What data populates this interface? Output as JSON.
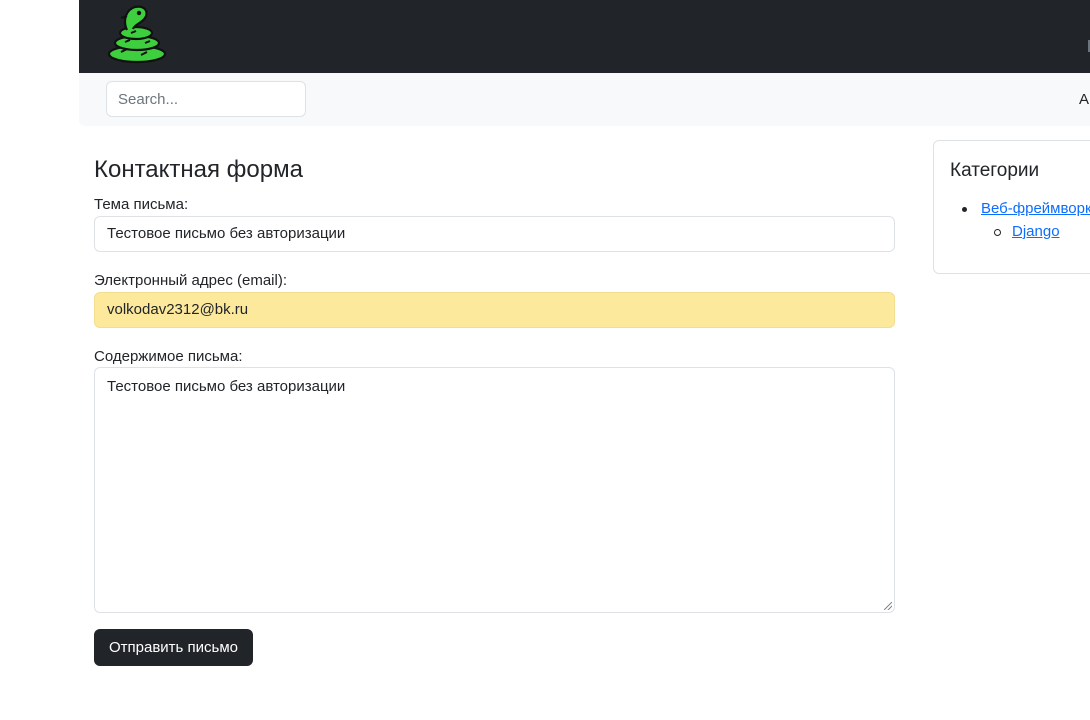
{
  "header": {
    "logo": "snake-logo",
    "right_text": ""
  },
  "search": {
    "placeholder": "Search..."
  },
  "subbar": {
    "right_text": "A"
  },
  "form": {
    "title": "Контактная форма",
    "subject_label": "Тема письма:",
    "subject_value": "Тестовое письмо без авторизации",
    "email_label": "Электронный адрес (email):",
    "email_value": "volkodav2312@bk.ru",
    "content_label": "Содержимое письма:",
    "content_value": "Тестовое письмо без авторизации",
    "submit_label": "Отправить письмо"
  },
  "sidebar": {
    "title": "Категории",
    "categories": [
      {
        "label": "Веб-фреймворки",
        "children": [
          {
            "label": "Django"
          }
        ]
      }
    ]
  },
  "colors": {
    "navbar": "#212529",
    "subbar": "#f8f9fa",
    "autofill": "#fde99c",
    "link": "#0d6efd",
    "button": "#212529"
  }
}
